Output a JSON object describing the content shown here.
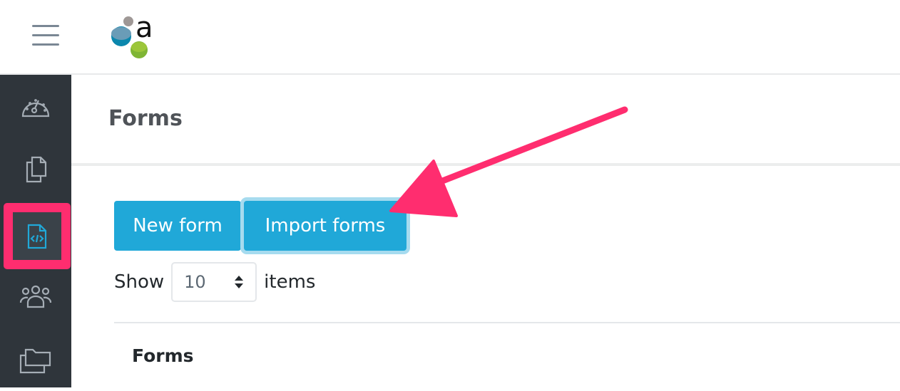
{
  "header": {
    "menu_icon": "hamburger-icon",
    "logo_letter": "a"
  },
  "sidebar": {
    "items": [
      {
        "icon": "dashboard-icon",
        "active": false
      },
      {
        "icon": "copy-documents-icon",
        "active": false
      },
      {
        "icon": "code-file-icon",
        "active": true
      },
      {
        "icon": "users-group-icon",
        "active": false
      },
      {
        "icon": "folders-icon",
        "active": false
      }
    ]
  },
  "main": {
    "page_title": "Forms",
    "buttons": {
      "new_form": "New form",
      "import_forms": "Import forms"
    },
    "show": {
      "label_before": "Show",
      "value": "10",
      "label_after": "items"
    },
    "table": {
      "header": "Forms"
    }
  },
  "colors": {
    "accent": "#20a8d8",
    "sidebar": "#2f353b",
    "annotation": "#ff2d6f"
  }
}
